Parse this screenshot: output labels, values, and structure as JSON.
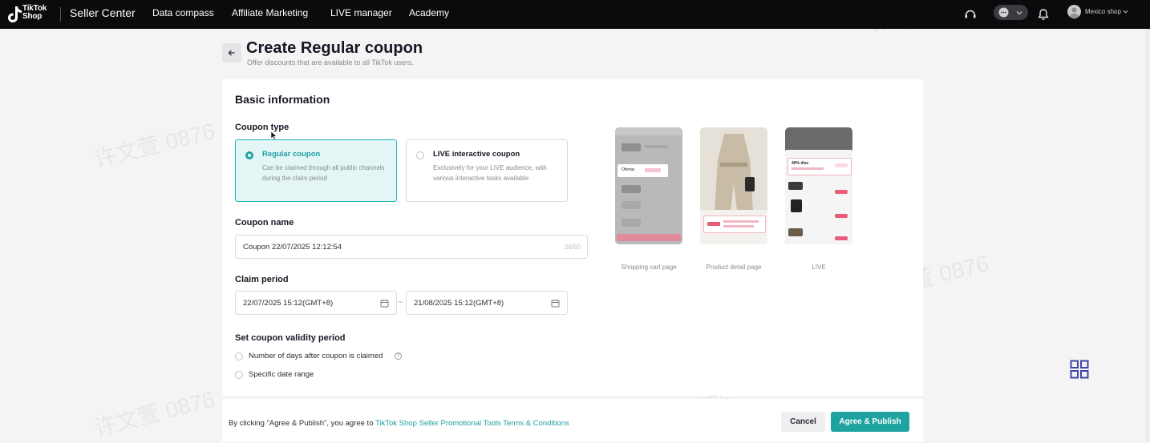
{
  "topbar": {
    "logo_line1": "TikTok",
    "logo_line2": "Shop",
    "brand": "Seller Center",
    "nav": [
      "Data compass",
      "Affiliate Marketing",
      "LIVE manager",
      "Academy"
    ],
    "shop_name": "Mexico shop",
    "icons": [
      "headset-icon",
      "chat-icon",
      "bell-icon"
    ]
  },
  "header": {
    "title": "Create Regular coupon",
    "subtitle": "Offer discounts that are available to all TikTok users."
  },
  "form": {
    "section_title": "Basic information",
    "coupon_type": {
      "label": "Coupon type",
      "options": [
        {
          "title": "Regular coupon",
          "desc": "Can be claimed through all public channels during the claim period",
          "selected": true
        },
        {
          "title": "LIVE interactive coupon",
          "desc": "Exclusively for your LIVE audience, with various interactive tasks available",
          "selected": false
        }
      ]
    },
    "coupon_name": {
      "label": "Coupon name",
      "value": "Coupon 22/07/2025 12:12:54",
      "counter": "26/50"
    },
    "claim_period": {
      "label": "Claim period",
      "start": "22/07/2025 15:12(GMT+8)",
      "separator": "~",
      "end": "21/08/2025 15:12(GMT+8)"
    },
    "validity": {
      "label": "Set coupon validity period",
      "options": [
        "Number of days after coupon is claimed",
        "Specific date range"
      ]
    }
  },
  "previews": {
    "captions": [
      "Shopping cart page",
      "Product detail page",
      "LIVE"
    ],
    "cart_badge": "Ofertas",
    "live_banner": "40% disc"
  },
  "footer": {
    "agree_prefix": "By clicking \"Agree & Publish\", you agree to",
    "agree_link": "TikTok Shop Seller Promotional Tools Terms & Conditions",
    "cancel": "Cancel",
    "publish": "Agree & Publish"
  },
  "watermark": "许文萱 0876",
  "colors": {
    "accent": "#1ea3a1",
    "selected_bg": "#e3f5f5",
    "topbar": "#0b0b0d"
  }
}
